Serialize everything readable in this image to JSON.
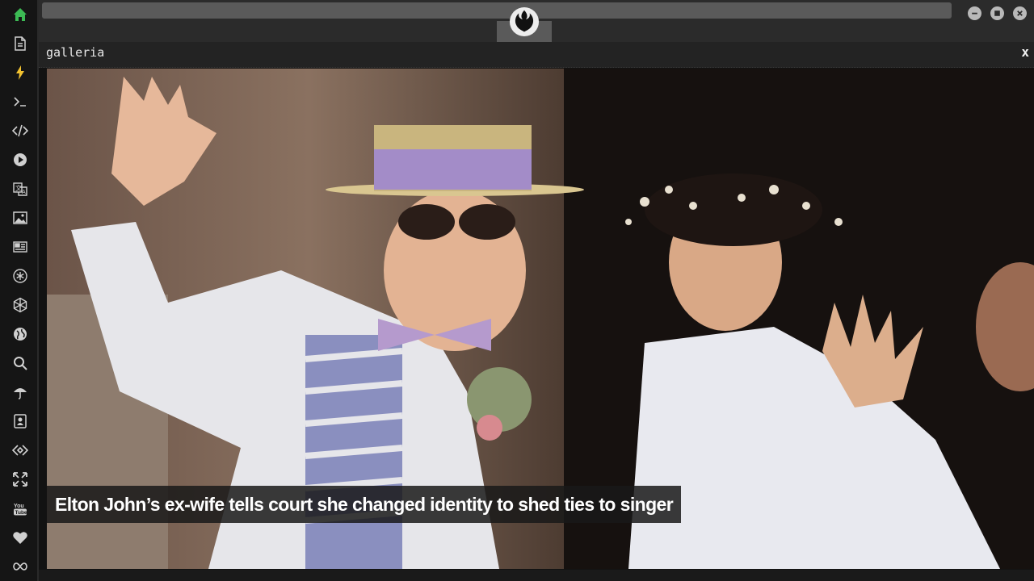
{
  "sidebar": {
    "items": [
      {
        "icon": "home-icon",
        "color": "#3cba54"
      },
      {
        "icon": "document-icon",
        "color": "#d0d0d0"
      },
      {
        "icon": "lightning-icon",
        "color": "#f2c230"
      },
      {
        "icon": "terminal-icon",
        "color": "#d0d0d0"
      },
      {
        "icon": "code-icon",
        "color": "#d0d0d0"
      },
      {
        "icon": "play-icon",
        "color": "#d0d0d0"
      },
      {
        "icon": "translate-icon",
        "color": "#d0d0d0"
      },
      {
        "icon": "image-icon",
        "color": "#d0d0d0"
      },
      {
        "icon": "newspaper-icon",
        "color": "#d0d0d0"
      },
      {
        "icon": "asterisk-circle-icon",
        "color": "#d0d0d0"
      },
      {
        "icon": "hexagon-icon",
        "color": "#d0d0d0"
      },
      {
        "icon": "globe-icon",
        "color": "#d0d0d0"
      },
      {
        "icon": "search-icon",
        "color": "#d0d0d0"
      },
      {
        "icon": "umbrella-icon",
        "color": "#d0d0d0"
      },
      {
        "icon": "contact-card-icon",
        "color": "#d0d0d0"
      },
      {
        "icon": "link-diamond-icon",
        "color": "#d0d0d0"
      },
      {
        "icon": "expand-arrows-icon",
        "color": "#d0d0d0"
      },
      {
        "icon": "youtube-icon",
        "color": "#d0d0d0"
      },
      {
        "icon": "heart-icon",
        "color": "#d0d0d0"
      },
      {
        "icon": "infinity-icon",
        "color": "#d0d0d0"
      }
    ]
  },
  "topbar": {
    "logo_icon": "rebel-alliance-logo-icon",
    "window_buttons": [
      "minimize-icon",
      "maximize-icon",
      "close-icon"
    ]
  },
  "panel": {
    "title": "galleria",
    "close_label": "x"
  },
  "photo": {
    "caption": "Elton John’s ex-wife tells court she changed identity to shed ties to singer"
  },
  "colors": {
    "accent_home": "#3cba54",
    "accent_bolt": "#f2c230",
    "panel_bg": "#232323"
  }
}
